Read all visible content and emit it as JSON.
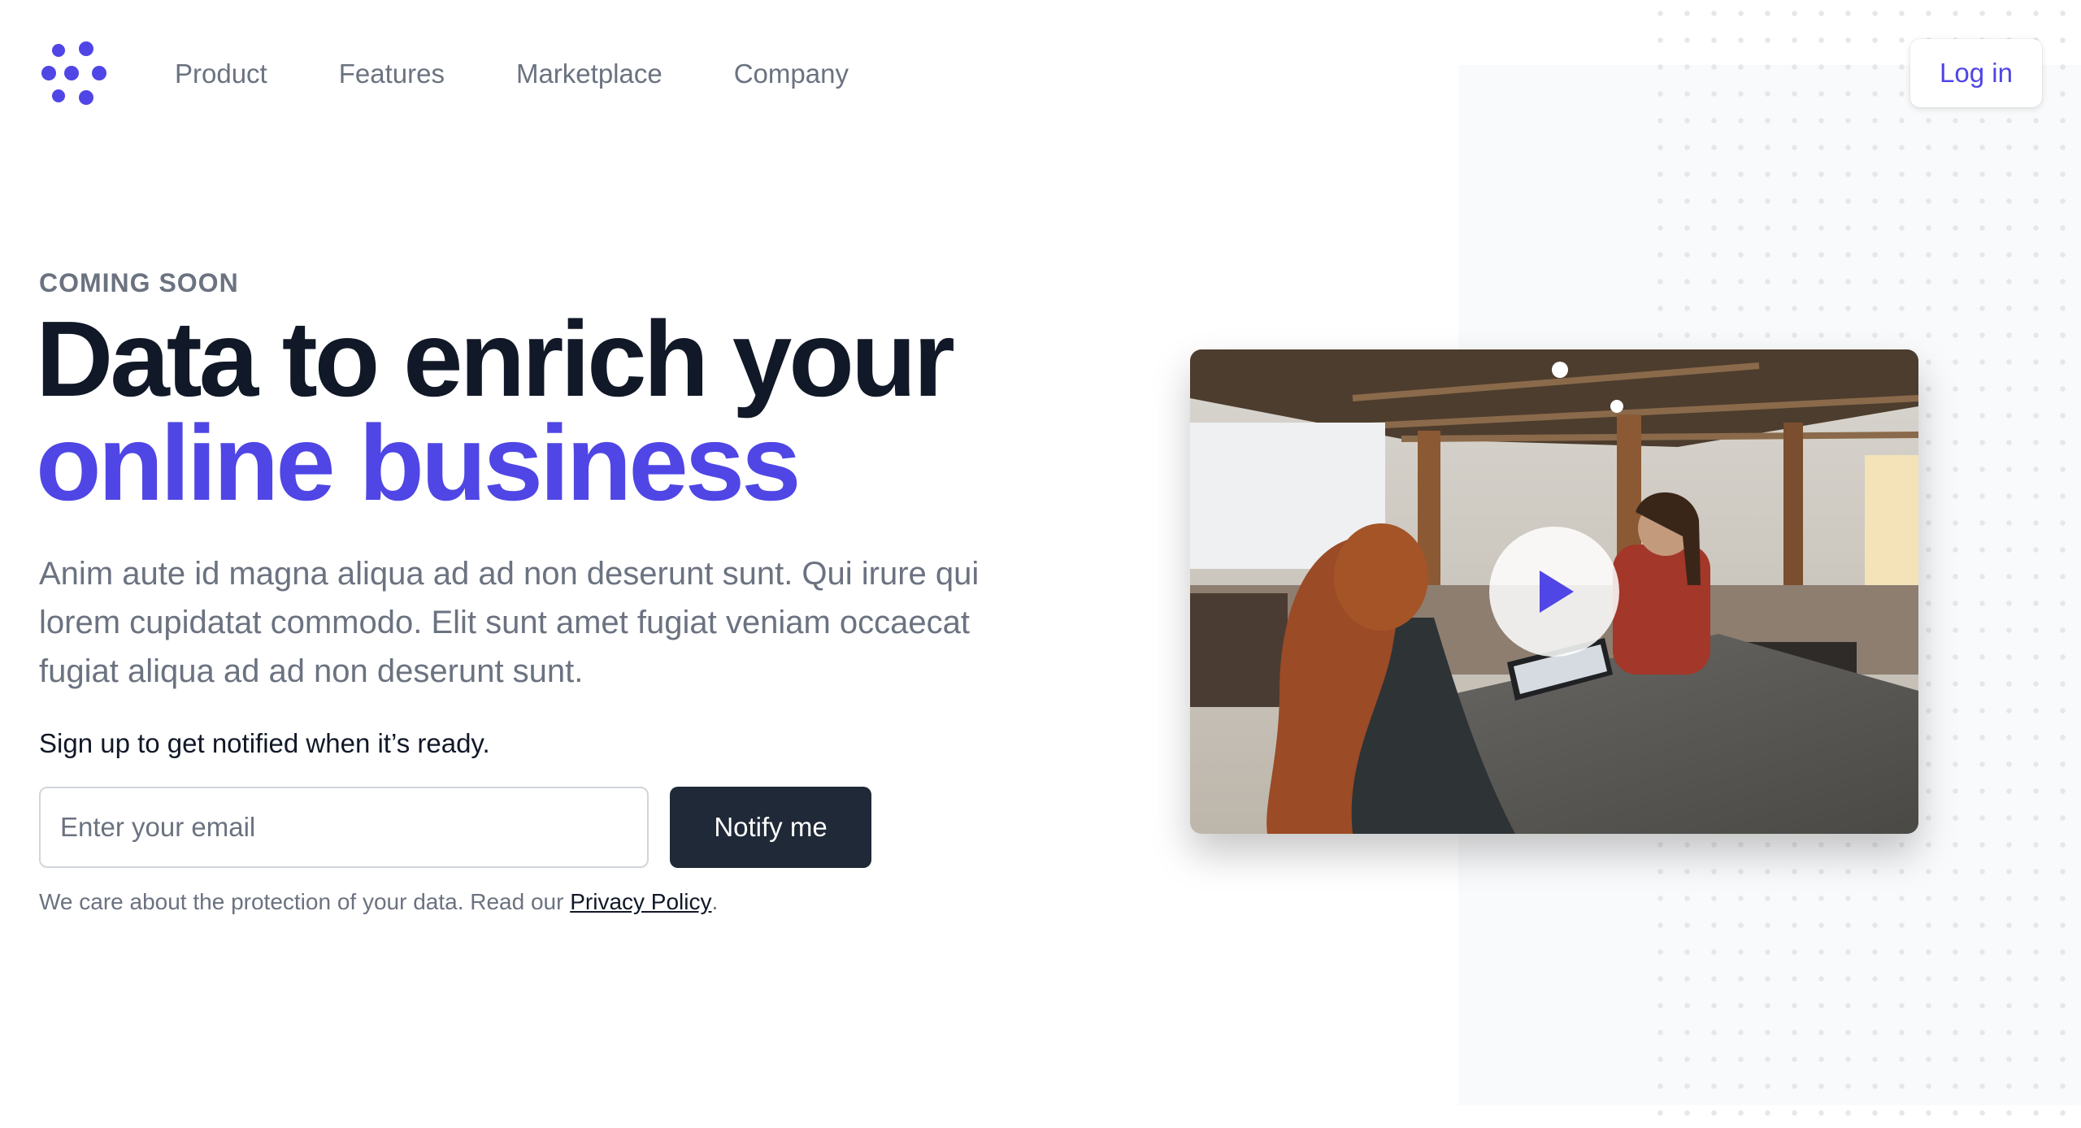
{
  "nav": {
    "items": [
      "Product",
      "Features",
      "Marketplace",
      "Company"
    ],
    "login_label": "Log in"
  },
  "hero": {
    "eyebrow": "COMING SOON",
    "title_line1": "Data to enrich your",
    "title_line2": "online business",
    "lead": "Anim aute id magna aliqua ad ad non deserunt sunt. Qui irure qui lorem cupidatat commodo. Elit sunt amet fugiat veniam occaecat fugiat aliqua ad ad non deserunt sunt.",
    "signup_label": "Sign up to get notified when it’s ready.",
    "email_placeholder": "Enter your email",
    "notify_label": "Notify me",
    "privacy_prefix": "We care about the protection of your data. Read our ",
    "privacy_link": "Privacy Policy",
    "privacy_suffix": "."
  },
  "icons": {
    "logo": "brand-logo-icon",
    "play": "play-icon"
  },
  "colors": {
    "accent": "#4f46e5",
    "dark_button": "#1f2937",
    "heading": "#111827",
    "muted": "#6b7280"
  }
}
